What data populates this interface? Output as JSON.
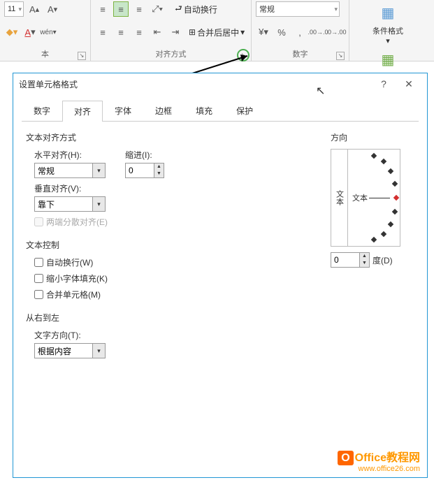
{
  "ribbon": {
    "font_size": "11",
    "wrap_text": "自动换行",
    "merge_center": "合并后居中",
    "align_group": "对齐方式",
    "number_format": "常规",
    "number_group": "数字",
    "pinyin": "wén",
    "cond_fmt": "条件格式",
    "table_fmt": "套用\n表格格式",
    "clipboard_group": "本"
  },
  "dialog": {
    "title": "设置单元格格式",
    "tabs": [
      "数字",
      "对齐",
      "字体",
      "边框",
      "填充",
      "保护"
    ],
    "text_align_section": "文本对齐方式",
    "h_align_label": "水平对齐(H):",
    "h_align_value": "常规",
    "indent_label": "缩进(I):",
    "indent_value": "0",
    "v_align_label": "垂直对齐(V):",
    "v_align_value": "靠下",
    "distribute_label": "两端分散对齐(E)",
    "text_control_section": "文本控制",
    "wrap_label": "自动换行(W)",
    "shrink_label": "缩小字体填充(K)",
    "merge_label": "合并单元格(M)",
    "rtl_section": "从右到左",
    "text_dir_label": "文字方向(T):",
    "text_dir_value": "根据内容",
    "orientation_section": "方向",
    "orientation_v": "文本",
    "orientation_h": "文本",
    "degrees_value": "0",
    "degrees_label": "度(D)"
  },
  "watermark": {
    "brand": "Office教程网",
    "url": "www.office26.com"
  }
}
